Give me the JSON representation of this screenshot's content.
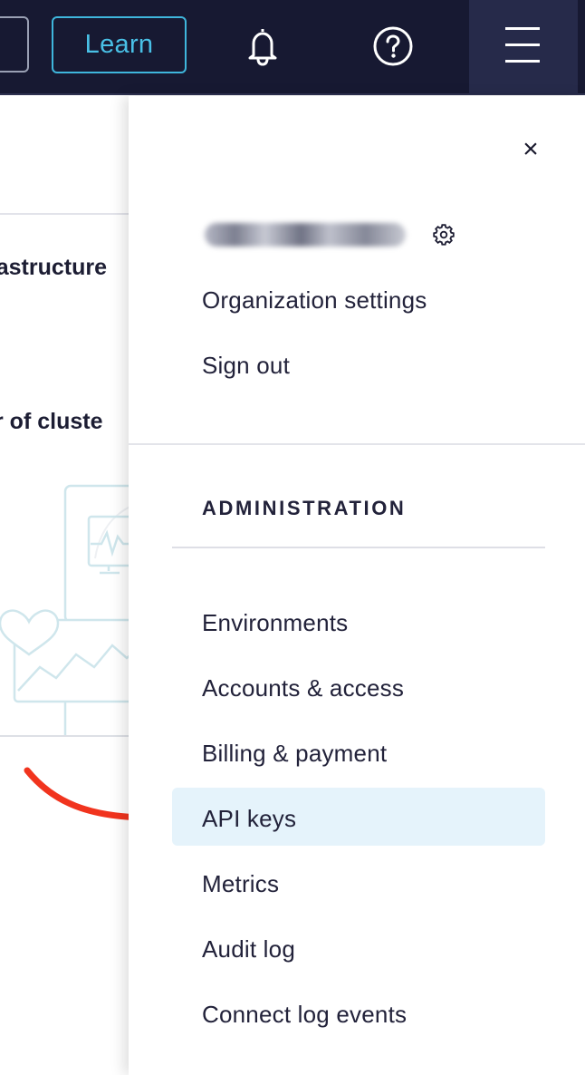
{
  "header": {
    "learn_label": "Learn",
    "icons": [
      "bell-icon",
      "help-icon",
      "hamburger-menu-icon"
    ],
    "background_color": "#171932",
    "accent_color": "#49c0e6"
  },
  "background_page": {
    "text_fragment_1": "rastructure",
    "text_fragment_2": "r of cluste"
  },
  "drawer": {
    "close_symbol": "×",
    "account_links": [
      {
        "label": "Organization settings"
      },
      {
        "label": "Sign out"
      }
    ],
    "section_title": "ADMINISTRATION",
    "admin_links": [
      {
        "label": "Environments",
        "selected": false
      },
      {
        "label": "Accounts & access",
        "selected": false
      },
      {
        "label": "Billing & payment",
        "selected": false
      },
      {
        "label": "API keys",
        "selected": true
      },
      {
        "label": "Metrics",
        "selected": false
      },
      {
        "label": "Audit log",
        "selected": false
      },
      {
        "label": "Connect log events",
        "selected": false
      }
    ],
    "highlight_color": "#e5f3fb"
  },
  "annotation": {
    "arrow_color": "#f1341e"
  }
}
